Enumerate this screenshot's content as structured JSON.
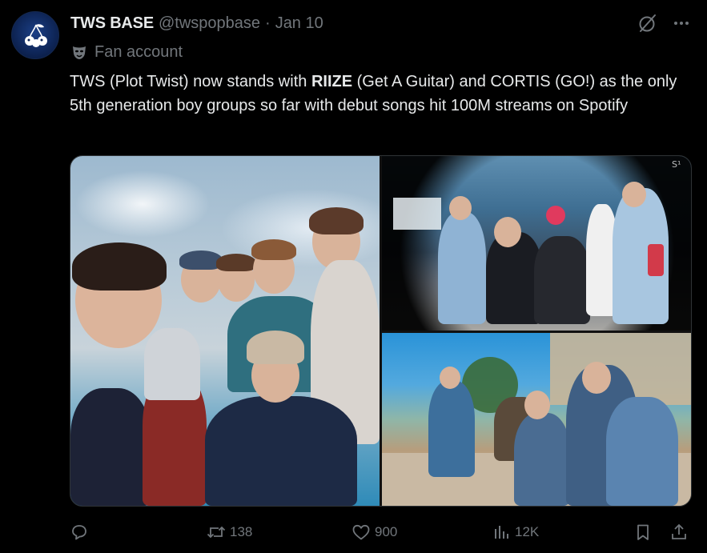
{
  "author": {
    "name": "TWS BASE",
    "handle": "@twspopbase",
    "separator": "·",
    "date": "Jan 10",
    "label": "Fan account"
  },
  "tweet": {
    "text_part1": "TWS (Plot Twist) now stands with ",
    "text_bold": "RIIZE",
    "text_part2": " (Get A Guitar) and CORTIS (GO!) as the only 5th generation boy groups so far with debut songs hit 100M streams on Spotify"
  },
  "media": {
    "count": 3,
    "badge_text": "S¹"
  },
  "stats": {
    "retweets": "138",
    "likes": "900",
    "views": "12K"
  },
  "icons": {
    "avatar": "cherry-logo-icon",
    "grok": "grok-icon",
    "more": "more-icon",
    "label": "mask-icon",
    "reply": "reply-icon",
    "retweet": "retweet-icon",
    "like": "heart-icon",
    "views": "views-icon",
    "bookmark": "bookmark-icon",
    "share": "share-icon"
  },
  "colors": {
    "background": "#000000",
    "text_primary": "#e7e9ea",
    "text_secondary": "#71767b",
    "border": "#2f3336",
    "avatar_bg": "#0e2556"
  }
}
